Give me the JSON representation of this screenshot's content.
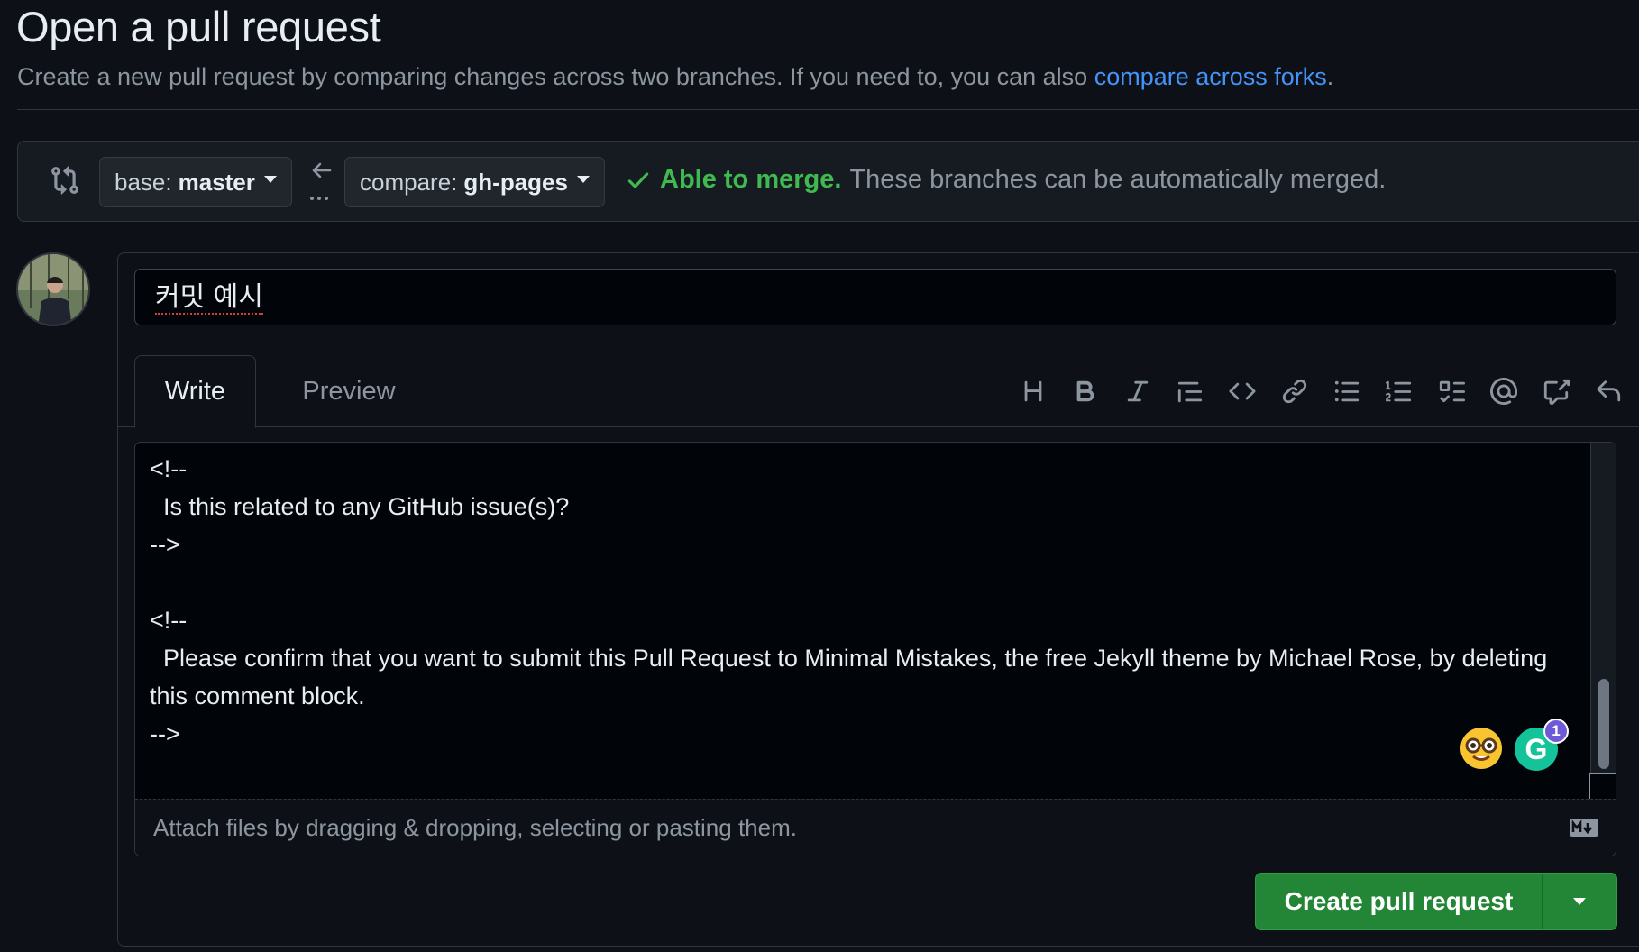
{
  "header": {
    "title": "Open a pull request",
    "subtitle": "Create a new pull request by comparing changes across two branches. If you need to, you can also ",
    "subtitle_link": "compare across forks",
    "subtitle_end": "."
  },
  "range": {
    "base_prefix": "base:",
    "base_branch": "master",
    "compare_prefix": "compare:",
    "compare_branch": "gh-pages",
    "merge_status": "Able to merge.",
    "merge_detail": "These branches can be automatically merged."
  },
  "form": {
    "title_value": "커밋 예시",
    "tabs": [
      {
        "label": "Write",
        "active": true
      },
      {
        "label": "Preview",
        "active": false
      }
    ],
    "toolbar_icons": [
      "heading-icon",
      "bold-icon",
      "italic-icon",
      "quote-icon",
      "code-icon",
      "link-icon",
      "bulleted-list-icon",
      "numbered-list-icon",
      "task-list-icon",
      "mention-icon",
      "cross-reference-icon",
      "undo-icon"
    ],
    "body": "<!--\n  Is this related to any GitHub issue(s)?\n-->\n\n<!--\n  Please confirm that you want to submit this Pull Request to Minimal Mistakes, the free Jekyll theme by Michael Rose, by deleting this comment block.\n-->",
    "grammarly_count": "1",
    "attach_hint": "Attach files by dragging & dropping, selecting or pasting them."
  },
  "actions": {
    "create_label": "Create pull request"
  },
  "colors": {
    "accent_green": "#238636",
    "link_blue": "#4493f8",
    "success": "#3fb950"
  }
}
